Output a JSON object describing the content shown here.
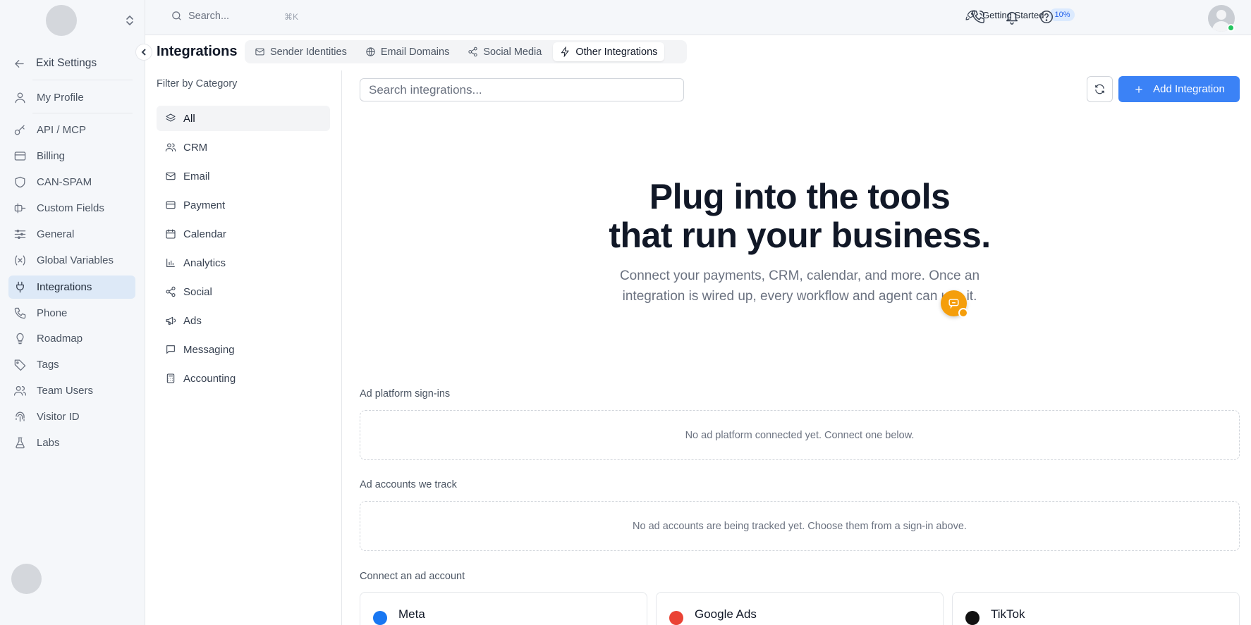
{
  "sidebar": {
    "exit_label": "Exit Settings",
    "items": [
      {
        "label": "My Profile",
        "icon": "user-icon"
      },
      {
        "label": "API / MCP",
        "icon": "key-icon"
      },
      {
        "label": "Billing",
        "icon": "credit-card-icon"
      },
      {
        "label": "CAN-SPAM",
        "icon": "shield-icon"
      },
      {
        "label": "Custom Fields",
        "icon": "custom-fields-icon"
      },
      {
        "label": "General",
        "icon": "sliders-icon"
      },
      {
        "label": "Global Variables",
        "icon": "variable-icon"
      },
      {
        "label": "Integrations",
        "icon": "plug-icon"
      },
      {
        "label": "Phone",
        "icon": "phone-icon"
      },
      {
        "label": "Roadmap",
        "icon": "lightbulb-icon"
      },
      {
        "label": "Tags",
        "icon": "tag-icon"
      },
      {
        "label": "Team Users",
        "icon": "users-icon"
      },
      {
        "label": "Visitor ID",
        "icon": "fingerprint-icon"
      },
      {
        "label": "Labs",
        "icon": "flask-icon"
      }
    ],
    "active_item": "Integrations"
  },
  "topbar": {
    "search_placeholder": "Search...",
    "search_shortcut": "⌘K",
    "getting_started_label": "Getting Started",
    "getting_started_progress": "10%"
  },
  "header": {
    "title": "Integrations",
    "tabs": [
      {
        "label": "Sender Identities",
        "icon": "mail-icon"
      },
      {
        "label": "Email Domains",
        "icon": "globe-icon"
      },
      {
        "label": "Social Media",
        "icon": "share-icon"
      },
      {
        "label": "Other Integrations",
        "icon": "zap-icon"
      }
    ],
    "active_tab": "Other Integrations"
  },
  "filter": {
    "title": "Filter by Category",
    "categories": [
      {
        "label": "All",
        "icon": "layers-icon"
      },
      {
        "label": "CRM",
        "icon": "users-icon"
      },
      {
        "label": "Email",
        "icon": "mail-icon"
      },
      {
        "label": "Payment",
        "icon": "credit-card-icon"
      },
      {
        "label": "Calendar",
        "icon": "calendar-icon"
      },
      {
        "label": "Analytics",
        "icon": "bar-chart-icon"
      },
      {
        "label": "Social",
        "icon": "share-icon"
      },
      {
        "label": "Ads",
        "icon": "megaphone-icon"
      },
      {
        "label": "Messaging",
        "icon": "message-icon"
      },
      {
        "label": "Accounting",
        "icon": "calculator-icon"
      }
    ],
    "active_category": "All"
  },
  "main": {
    "search_placeholder": "Search integrations...",
    "add_button_label": "Add Integration",
    "hero_title_line1": "Plug into the tools",
    "hero_title_line2": "that run your business.",
    "hero_subtitle_line1": "Connect your payments, CRM, calendar, and more. Once an",
    "hero_subtitle_line2": "integration is wired up, every workflow and agent can use it.",
    "section_platform_label": "Ad platform sign-ins",
    "section_platform_empty": "No ad platform connected yet. Connect one below.",
    "section_accounts_label": "Ad accounts we track",
    "section_accounts_empty": "No ad accounts are being tracked yet. Choose them from a sign-in above.",
    "section_connect_label": "Connect an ad account",
    "ad_cards": [
      {
        "name": "Meta",
        "color": "#1877f2"
      },
      {
        "name": "Google Ads",
        "color": "#ea4335"
      },
      {
        "name": "TikTok",
        "color": "#111111"
      }
    ]
  },
  "colors": {
    "accent": "#3b82f6",
    "active_nav_bg": "#dde9f7",
    "chat_widget": "#f59e0b",
    "online_status": "#22c55e"
  }
}
